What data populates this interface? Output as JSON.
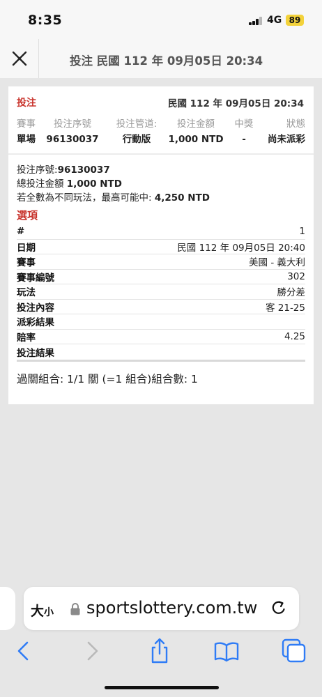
{
  "status": {
    "time": "8:35",
    "network": "4G",
    "battery": "89"
  },
  "header": {
    "title": "投注 民國 112 年 09月05日 20:34"
  },
  "card": {
    "title": "投注",
    "date": "民國 112 年 09月05日 20:34",
    "summary_headers": [
      "賽事",
      "投注序號",
      "投注管道:",
      "投注金額",
      "中獎",
      "狀態"
    ],
    "summary_values": [
      "單場",
      "96130037",
      "行動版",
      "1,000 NTD",
      "-",
      "尚未派彩"
    ],
    "info": {
      "serial_label": "投注序號:",
      "serial_value": "96130037",
      "amount_label": "總投注金額",
      "amount_value": "1,000 NTD",
      "max_label": "若全數為不同玩法，最高可能中:",
      "max_value": "4,250 NTD"
    },
    "options_title": "選項",
    "options": [
      {
        "label": "#",
        "value": "1"
      },
      {
        "label": "日期",
        "value": "民國 112 年 09月05日 20:40"
      },
      {
        "label": "賽事",
        "value": "美國 - 義大利"
      },
      {
        "label": "賽事編號",
        "value": "302"
      },
      {
        "label": "玩法",
        "value": "勝分差"
      },
      {
        "label": "投注內容",
        "value": "客 21-25"
      },
      {
        "label": "派彩結果",
        "value": ""
      },
      {
        "label": "賠率",
        "value": "4.25"
      },
      {
        "label": "投注結果",
        "value": ""
      }
    ],
    "combo_text": "過關組合: 1/1 關 (=1 組合)組合數: 1"
  },
  "browser": {
    "text_size_big": "大",
    "text_size_small": "小",
    "url": "sportslottery.com.tw"
  },
  "icons": {
    "close": "close-icon",
    "lock": "lock-icon",
    "reload": "reload-icon",
    "back": "back-icon",
    "forward": "forward-icon",
    "share": "share-icon",
    "bookmarks": "bookmarks-icon",
    "tabs": "tabs-icon"
  },
  "colors": {
    "accent_red": "#c8322b",
    "ios_blue": "#2f7cf6",
    "battery": "#f3d23b"
  }
}
